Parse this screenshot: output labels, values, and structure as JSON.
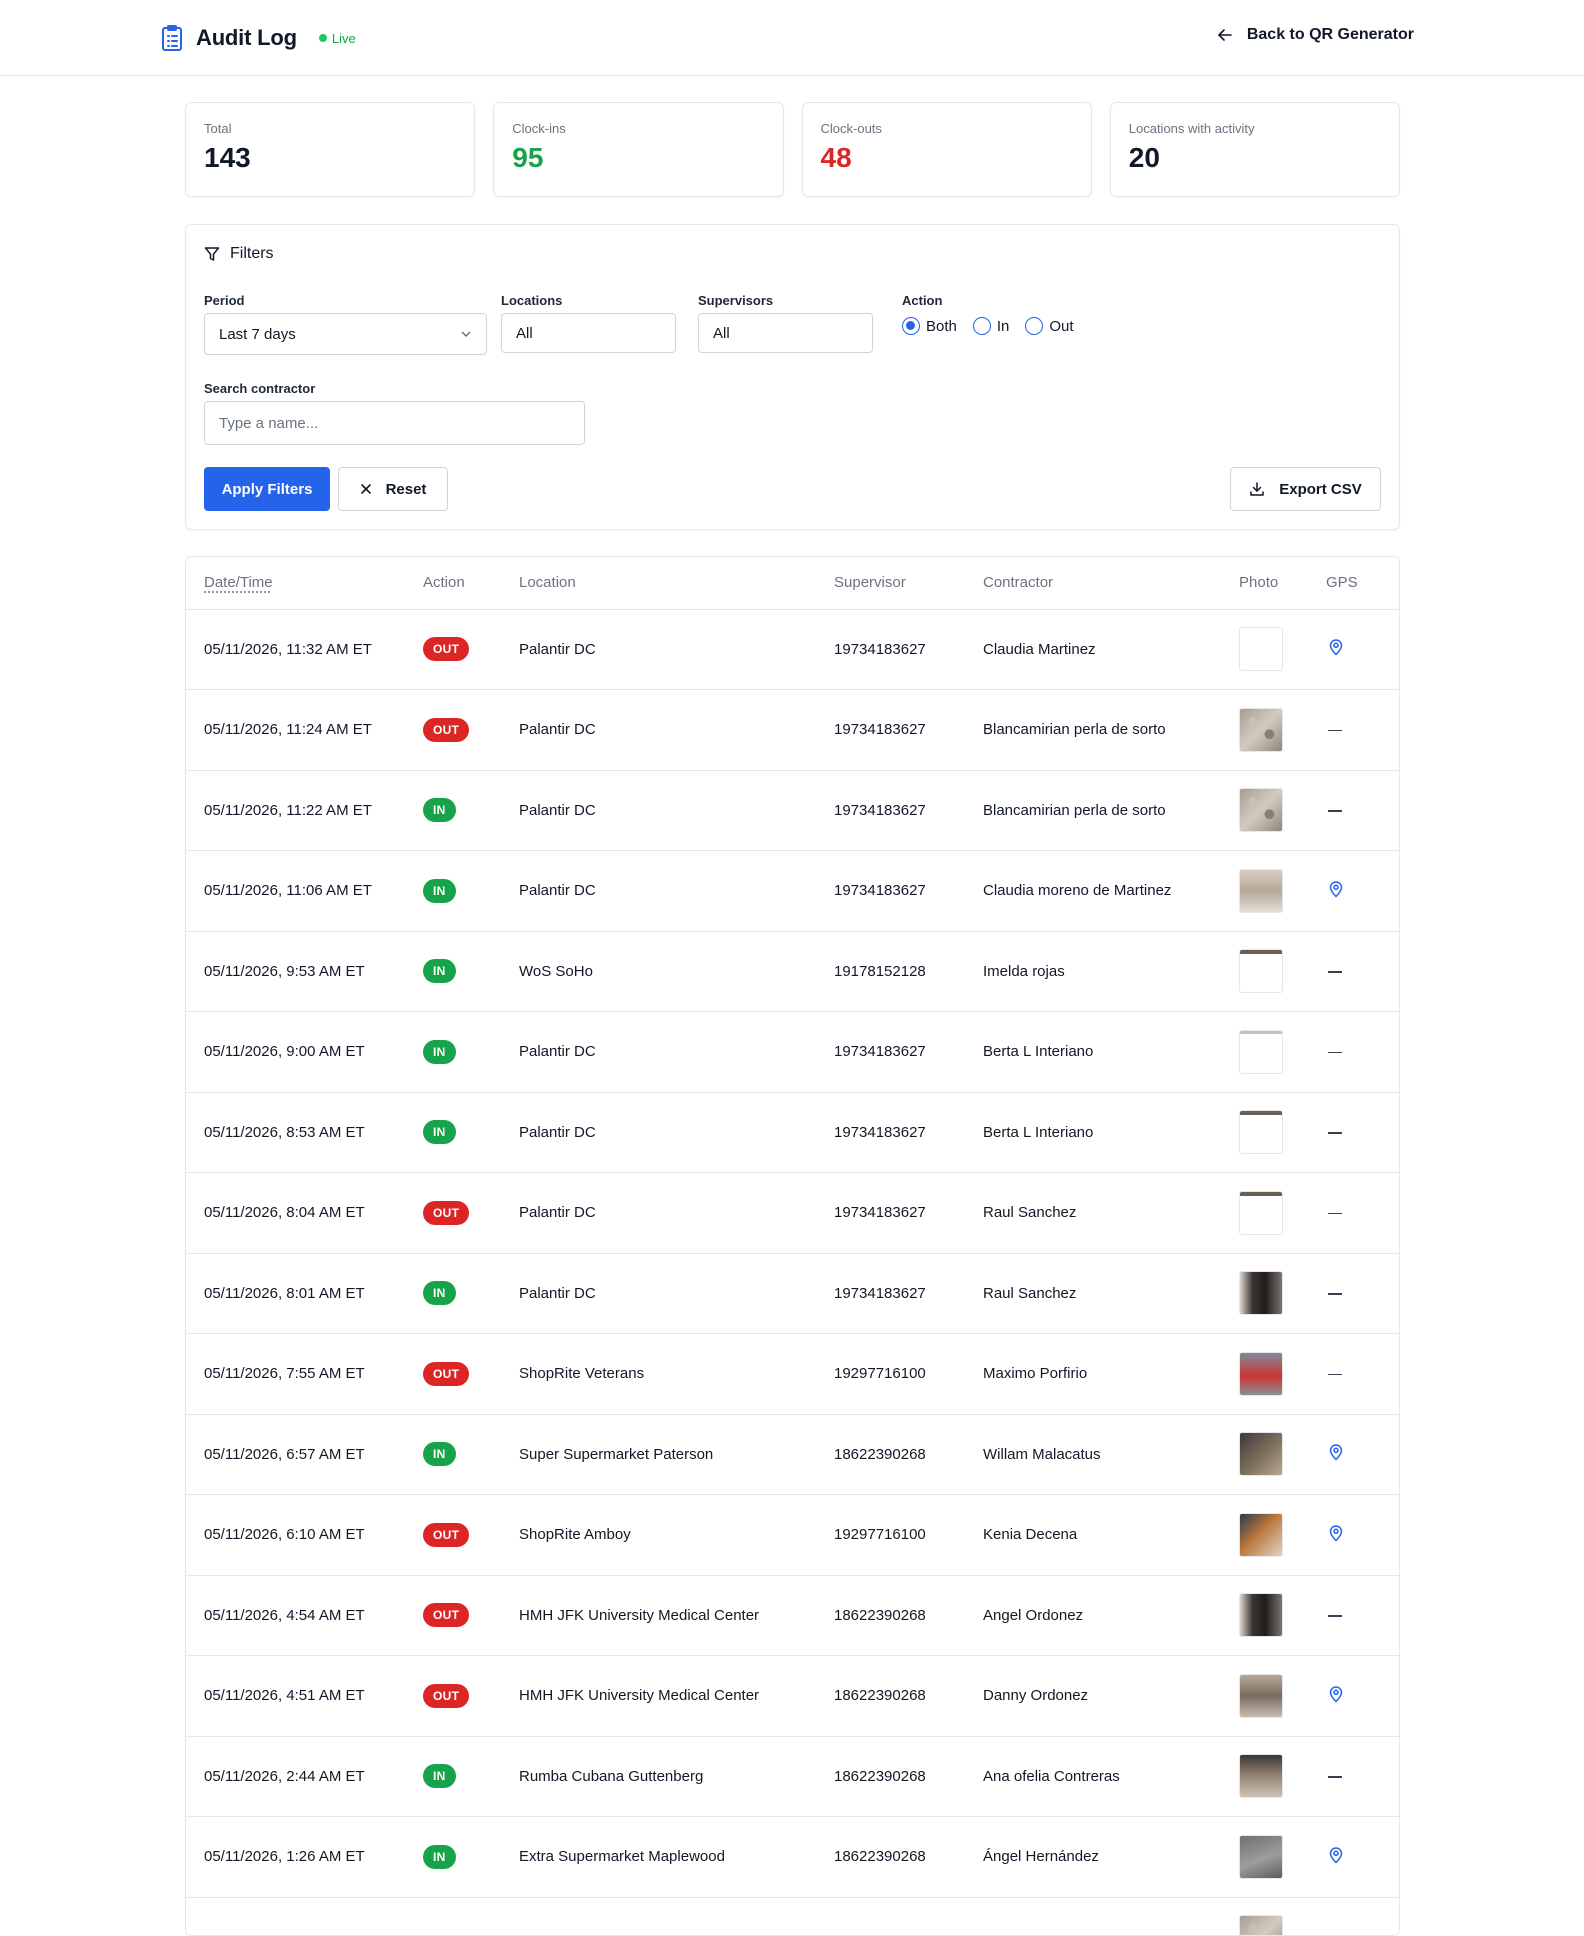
{
  "header": {
    "title": "Audit Log",
    "live_label": "Live",
    "back_label": "Back to QR Generator"
  },
  "stats": [
    {
      "label": "Total",
      "value": "143",
      "color": "#111827"
    },
    {
      "label": "Clock-ins",
      "value": "95",
      "color": "#16a34a"
    },
    {
      "label": "Clock-outs",
      "value": "48",
      "color": "#dc2626"
    },
    {
      "label": "Locations with activity",
      "value": "20",
      "color": "#111827"
    }
  ],
  "filters": {
    "title": "Filters",
    "period_label": "Period",
    "period_value": "Last 7 days",
    "locations_label": "Locations",
    "locations_value": "All",
    "supervisors_label": "Supervisors",
    "supervisors_value": "All",
    "action_label": "Action",
    "action_options": [
      "Both",
      "In",
      "Out"
    ],
    "action_selected": "Both",
    "search_label": "Search contractor",
    "search_placeholder": "Type a name...",
    "apply_label": "Apply Filters",
    "reset_label": "Reset",
    "export_label": "Export CSV"
  },
  "table": {
    "columns": [
      "Date/Time",
      "Action",
      "Location",
      "Supervisor",
      "Contractor",
      "Photo",
      "GPS"
    ],
    "rows": [
      {
        "datetime": "05/11/2026, 11:32 AM ET",
        "action": "OUT",
        "location": "Palantir DC",
        "supervisor": "19734183627",
        "contractor": "Claudia Martinez",
        "photo": "blank",
        "gps": true
      },
      {
        "datetime": "05/11/2026, 11:24 AM ET",
        "action": "OUT",
        "location": "Palantir DC",
        "supervisor": "19734183627",
        "contractor": "Blancamirian perla de sorto",
        "photo": "granite",
        "gps": false
      },
      {
        "datetime": "05/11/2026, 11:22 AM ET",
        "action": "IN",
        "location": "Palantir DC",
        "supervisor": "19734183627",
        "contractor": "Blancamirian perla de sorto",
        "photo": "granite",
        "gps": false
      },
      {
        "datetime": "05/11/2026, 11:06 AM ET",
        "action": "IN",
        "location": "Palantir DC",
        "supervisor": "19734183627",
        "contractor": "Claudia moreno de Martinez",
        "photo": "room",
        "gps": true
      },
      {
        "datetime": "05/11/2026, 9:53 AM ET",
        "action": "IN",
        "location": "WoS SoHo",
        "supervisor": "19178152128",
        "contractor": "Imelda rojas",
        "photo": "stripe",
        "gps": false
      },
      {
        "datetime": "05/11/2026, 9:00 AM ET",
        "action": "IN",
        "location": "Palantir DC",
        "supervisor": "19734183627",
        "contractor": "Berta L Interiano",
        "photo": "stripe-lite",
        "gps": false
      },
      {
        "datetime": "05/11/2026, 8:53 AM ET",
        "action": "IN",
        "location": "Palantir DC",
        "supervisor": "19734183627",
        "contractor": "Berta L Interiano",
        "photo": "stripe",
        "gps": false
      },
      {
        "datetime": "05/11/2026, 8:04 AM ET",
        "action": "OUT",
        "location": "Palantir DC",
        "supervisor": "19734183627",
        "contractor": "Raul Sanchez",
        "photo": "stripe",
        "gps": false
      },
      {
        "datetime": "05/11/2026, 8:01 AM ET",
        "action": "IN",
        "location": "Palantir DC",
        "supervisor": "19734183627",
        "contractor": "Raul Sanchez",
        "photo": "dark",
        "gps": false
      },
      {
        "datetime": "05/11/2026, 7:55 AM ET",
        "action": "OUT",
        "location": "ShopRite Veterans",
        "supervisor": "19297716100",
        "contractor": "Maximo Porfirio",
        "photo": "red",
        "gps": false
      },
      {
        "datetime": "05/11/2026, 6:57 AM ET",
        "action": "IN",
        "location": "Super Supermarket Paterson",
        "supervisor": "18622390268",
        "contractor": "Willam Malacatus",
        "photo": "store",
        "gps": true
      },
      {
        "datetime": "05/11/2026, 6:10 AM ET",
        "action": "OUT",
        "location": "ShopRite Amboy",
        "supervisor": "19297716100",
        "contractor": "Kenia Decena",
        "photo": "orange",
        "gps": true
      },
      {
        "datetime": "05/11/2026, 4:54 AM ET",
        "action": "OUT",
        "location": "HMH JFK University Medical Center",
        "supervisor": "18622390268",
        "contractor": "Angel Ordonez",
        "photo": "dark",
        "gps": false
      },
      {
        "datetime": "05/11/2026, 4:51 AM ET",
        "action": "OUT",
        "location": "HMH JFK University Medical Center",
        "supervisor": "18622390268",
        "contractor": "Danny Ordonez",
        "photo": "hall",
        "gps": true
      },
      {
        "datetime": "05/11/2026, 2:44 AM ET",
        "action": "IN",
        "location": "Rumba Cubana Guttenberg",
        "supervisor": "18622390268",
        "contractor": "Ana ofelia Contreras",
        "photo": "floor",
        "gps": false
      },
      {
        "datetime": "05/11/2026, 1:26 AM ET",
        "action": "IN",
        "location": "Extra Supermarket Maplewood",
        "supervisor": "18622390268",
        "contractor": "Ángel Hernández",
        "photo": "concrete",
        "gps": true
      },
      {
        "datetime": "",
        "action": "",
        "location": "",
        "supervisor": "",
        "contractor": "",
        "photo": "granite",
        "gps": false
      }
    ]
  },
  "colors": {
    "accent": "#2563eb",
    "in_badge": "#16a34a",
    "out_badge": "#dc2626",
    "live_dot": "#22c55e"
  },
  "icons": {
    "header": "clipboard-icon",
    "back": "arrow-left-icon",
    "filters": "funnel-icon",
    "period": "chevron-down-icon",
    "reset": "close-icon",
    "export": "download-icon",
    "gps": "map-pin-icon",
    "no_gps": "dash-icon"
  }
}
